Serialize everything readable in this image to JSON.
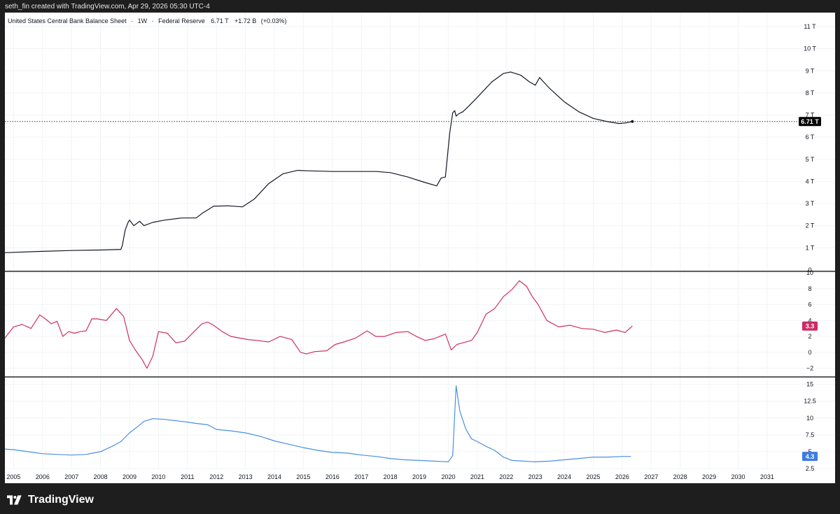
{
  "header": {
    "credit": "seth_fin created with TradingView.com, Apr 29, 2026 05:30 UTC-4"
  },
  "footer": {
    "brand": "TradingView"
  },
  "colors": {
    "balance_line": "#131722",
    "inflation_line": "#d12f5c",
    "unemployment_line": "#4a8fe0",
    "inflation_tag": "#cc2a66",
    "unemployment_tag": "#3d7be0",
    "balance_tag": "#000000",
    "grid": "#f1f3f6",
    "pane_divider": "#2a2a2a"
  },
  "chart_data": [
    {
      "type": "line",
      "pane": "main",
      "legend": {
        "title": "United States Central Bank Balance Sheet",
        "interval": "1W",
        "source": "Federal Reserve",
        "last": "6.71 T",
        "change": "+1.72 B",
        "change_pct": "(+0.03%)"
      },
      "last_value_tag": "6.71 T",
      "last_value": 6.71,
      "y_ticks": [
        0,
        1,
        2,
        3,
        4,
        5,
        6,
        7,
        8,
        9,
        10,
        11
      ],
      "y_tick_labels": [
        "0",
        "1 T",
        "2 T",
        "3 T",
        "4 T",
        "5 T",
        "6 T",
        "7 T",
        "8 T",
        "9 T",
        "10 T",
        "11 T"
      ],
      "ylim": [
        0,
        11
      ],
      "x": [
        2004.7,
        2006.0,
        2007.0,
        2008.0,
        2008.7,
        2008.75,
        2008.85,
        2008.95,
        2009.0,
        2009.15,
        2009.35,
        2009.5,
        2009.8,
        2010.2,
        2010.8,
        2011.3,
        2011.5,
        2011.9,
        2012.4,
        2012.9,
        2013.3,
        2013.8,
        2014.3,
        2014.8,
        2015.2,
        2016.0,
        2017.0,
        2017.5,
        2018.0,
        2018.6,
        2019.2,
        2019.6,
        2019.75,
        2019.9,
        2020.05,
        2020.15,
        2020.22,
        2020.27,
        2020.35,
        2020.5,
        2020.7,
        2021.0,
        2021.5,
        2021.9,
        2022.15,
        2022.5,
        2022.8,
        2023.0,
        2023.15,
        2023.25,
        2023.5,
        2024.0,
        2024.5,
        2025.0,
        2025.5,
        2025.9,
        2026.15,
        2026.35
      ],
      "y": [
        0.78,
        0.84,
        0.88,
        0.9,
        0.93,
        1.1,
        1.8,
        2.15,
        2.25,
        2.0,
        2.2,
        2.0,
        2.15,
        2.25,
        2.35,
        2.35,
        2.55,
        2.88,
        2.9,
        2.85,
        3.2,
        3.9,
        4.35,
        4.5,
        4.48,
        4.45,
        4.45,
        4.45,
        4.4,
        4.2,
        3.95,
        3.8,
        4.15,
        4.2,
        6.2,
        7.1,
        7.2,
        6.95,
        7.05,
        7.15,
        7.4,
        7.8,
        8.5,
        8.88,
        8.95,
        8.8,
        8.5,
        8.35,
        8.7,
        8.55,
        8.2,
        7.6,
        7.15,
        6.85,
        6.7,
        6.62,
        6.65,
        6.71
      ]
    },
    {
      "type": "line",
      "pane": "middle",
      "last_value_tag": "3.3",
      "last_value": 3.3,
      "y_ticks": [
        -2,
        0,
        2,
        4,
        6,
        8,
        10
      ],
      "y_tick_labels": [
        "−2",
        "0",
        "2",
        "4",
        "6",
        "8",
        "10"
      ],
      "ylim": [
        -3,
        10
      ],
      "x": [
        2004.7,
        2005.0,
        2005.3,
        2005.6,
        2005.9,
        2006.1,
        2006.3,
        2006.5,
        2006.7,
        2006.9,
        2007.1,
        2007.3,
        2007.5,
        2007.7,
        2007.9,
        2008.2,
        2008.55,
        2008.8,
        2009.0,
        2009.2,
        2009.45,
        2009.6,
        2009.8,
        2010.0,
        2010.3,
        2010.6,
        2010.9,
        2011.2,
        2011.5,
        2011.7,
        2011.9,
        2012.2,
        2012.5,
        2012.8,
        2013.1,
        2013.4,
        2013.8,
        2014.2,
        2014.6,
        2014.9,
        2015.1,
        2015.4,
        2015.8,
        2016.1,
        2016.4,
        2016.8,
        2017.2,
        2017.5,
        2017.8,
        2018.2,
        2018.6,
        2018.9,
        2019.2,
        2019.5,
        2019.9,
        2020.1,
        2020.3,
        2020.5,
        2020.8,
        2021.0,
        2021.3,
        2021.6,
        2021.9,
        2022.2,
        2022.45,
        2022.7,
        2022.9,
        2023.1,
        2023.4,
        2023.8,
        2024.2,
        2024.6,
        2025.0,
        2025.4,
        2025.8,
        2026.1,
        2026.35
      ],
      "y": [
        1.8,
        3.2,
        3.5,
        3.0,
        4.7,
        4.2,
        3.6,
        3.9,
        2.0,
        2.6,
        2.4,
        2.6,
        2.7,
        4.2,
        4.2,
        4.0,
        5.5,
        4.5,
        1.5,
        0.3,
        -1.0,
        -2.0,
        -0.5,
        2.6,
        2.4,
        1.2,
        1.4,
        2.5,
        3.6,
        3.8,
        3.4,
        2.6,
        2.0,
        1.8,
        1.6,
        1.5,
        1.3,
        2.0,
        1.6,
        0.0,
        -0.2,
        0.1,
        0.2,
        1.0,
        1.3,
        1.8,
        2.7,
        2.0,
        2.0,
        2.5,
        2.6,
        2.0,
        1.5,
        1.7,
        2.3,
        0.3,
        1.0,
        1.2,
        1.5,
        2.5,
        4.8,
        5.5,
        7.0,
        7.9,
        9.0,
        8.3,
        7.0,
        6.0,
        4.0,
        3.2,
        3.4,
        3.0,
        2.9,
        2.5,
        2.8,
        2.5,
        3.3
      ]
    },
    {
      "type": "line",
      "pane": "bottom",
      "last_value_tag": "4.3",
      "last_value": 4.3,
      "y_ticks": [
        2.5,
        5,
        7.5,
        10,
        12.5,
        15
      ],
      "y_tick_labels": [
        "2.5",
        "5",
        "7.5",
        "10",
        "12.5",
        "15"
      ],
      "ylim": [
        2.5,
        16
      ],
      "x": [
        2004.7,
        2005.0,
        2005.5,
        2006.0,
        2006.5,
        2007.0,
        2007.5,
        2008.0,
        2008.4,
        2008.7,
        2009.0,
        2009.3,
        2009.5,
        2009.8,
        2010.2,
        2010.6,
        2011.0,
        2011.3,
        2011.7,
        2012.0,
        2012.5,
        2013.0,
        2013.5,
        2014.0,
        2014.5,
        2015.0,
        2015.5,
        2016.0,
        2016.5,
        2017.0,
        2017.5,
        2018.0,
        2018.5,
        2019.0,
        2019.5,
        2020.0,
        2020.15,
        2020.27,
        2020.4,
        2020.6,
        2020.8,
        2021.0,
        2021.3,
        2021.6,
        2021.9,
        2022.2,
        2022.6,
        2023.0,
        2023.5,
        2024.0,
        2024.5,
        2025.0,
        2025.5,
        2026.0,
        2026.3
      ],
      "y": [
        5.4,
        5.3,
        5.0,
        4.7,
        4.6,
        4.5,
        4.6,
        5.0,
        5.8,
        6.5,
        7.8,
        8.8,
        9.5,
        9.9,
        9.8,
        9.6,
        9.4,
        9.2,
        9.0,
        8.3,
        8.1,
        7.8,
        7.3,
        6.6,
        6.1,
        5.6,
        5.2,
        4.9,
        4.8,
        4.5,
        4.3,
        4.0,
        3.8,
        3.7,
        3.6,
        3.5,
        4.4,
        14.8,
        11.0,
        8.4,
        6.9,
        6.5,
        5.8,
        5.2,
        4.2,
        3.7,
        3.6,
        3.5,
        3.6,
        3.8,
        4.0,
        4.2,
        4.2,
        4.3,
        4.3
      ]
    }
  ],
  "x_axis": {
    "tick_values": [
      2005,
      2006,
      2007,
      2008,
      2009,
      2010,
      2011,
      2012,
      2013,
      2014,
      2015,
      2016,
      2017,
      2018,
      2019,
      2020,
      2021,
      2022,
      2023,
      2024,
      2025,
      2026,
      2027,
      2028,
      2029,
      2030,
      2031
    ],
    "tick_labels": [
      "2005",
      "2006",
      "2007",
      "2008",
      "2009",
      "2010",
      "2011",
      "2012",
      "2013",
      "2014",
      "2015",
      "2016",
      "2017",
      "2018",
      "2019",
      "2020",
      "2021",
      "2022",
      "2023",
      "2024",
      "2025",
      "2026",
      "2027",
      "2028",
      "2029",
      "2030",
      "2031"
    ],
    "range": [
      2004.7,
      2031.8
    ]
  }
}
